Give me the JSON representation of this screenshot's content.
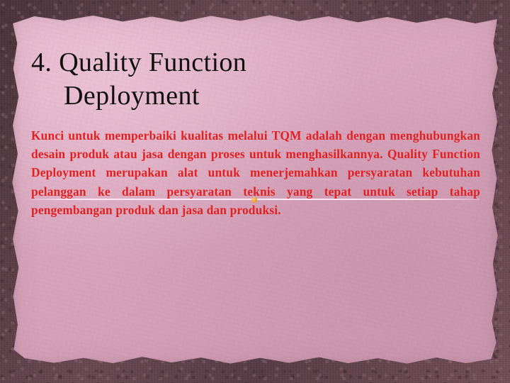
{
  "slide": {
    "title": {
      "line1": "4. Quality Function",
      "line2": "Deployment"
    },
    "body": {
      "line1": "Kunci untuk memperbaiki kualitas melalui TQM adalah",
      "line2": "dengan menghubungkan desain produk atau jasa dengan",
      "line3": "proses untuk menghasilkannya. Quality Function",
      "line4": "Deployment merupakan alat untuk menerjemahkan",
      "line5": "persyaratan kebutuhan pelanggan ke dalam persyaratan",
      "line6": "teknis yang tepat untuk setiap tahap pengembangan produk",
      "line7": "dan jasa dan produksi.",
      "full_text": "Kunci untuk memperbaiki kualitas melalui TQM adalah dengan menghubungkan desain produk atau jasa dengan proses untuk menghasilkannya. Quality Function Deployment merupakan alat untuk menerjemahkan persyaratan kebutuhan pelanggan ke dalam persyaratan teknis yang tepat untuk setiap tahap pengembangan produk dan jasa dan produksi."
    },
    "colors": {
      "title_text": "#12100f",
      "body_text": "#e02222",
      "paper": "#d9a7be",
      "frame": "#5e4049",
      "marker_dot": "#f2a63c",
      "rule_artifact": "#ffeef8"
    }
  }
}
